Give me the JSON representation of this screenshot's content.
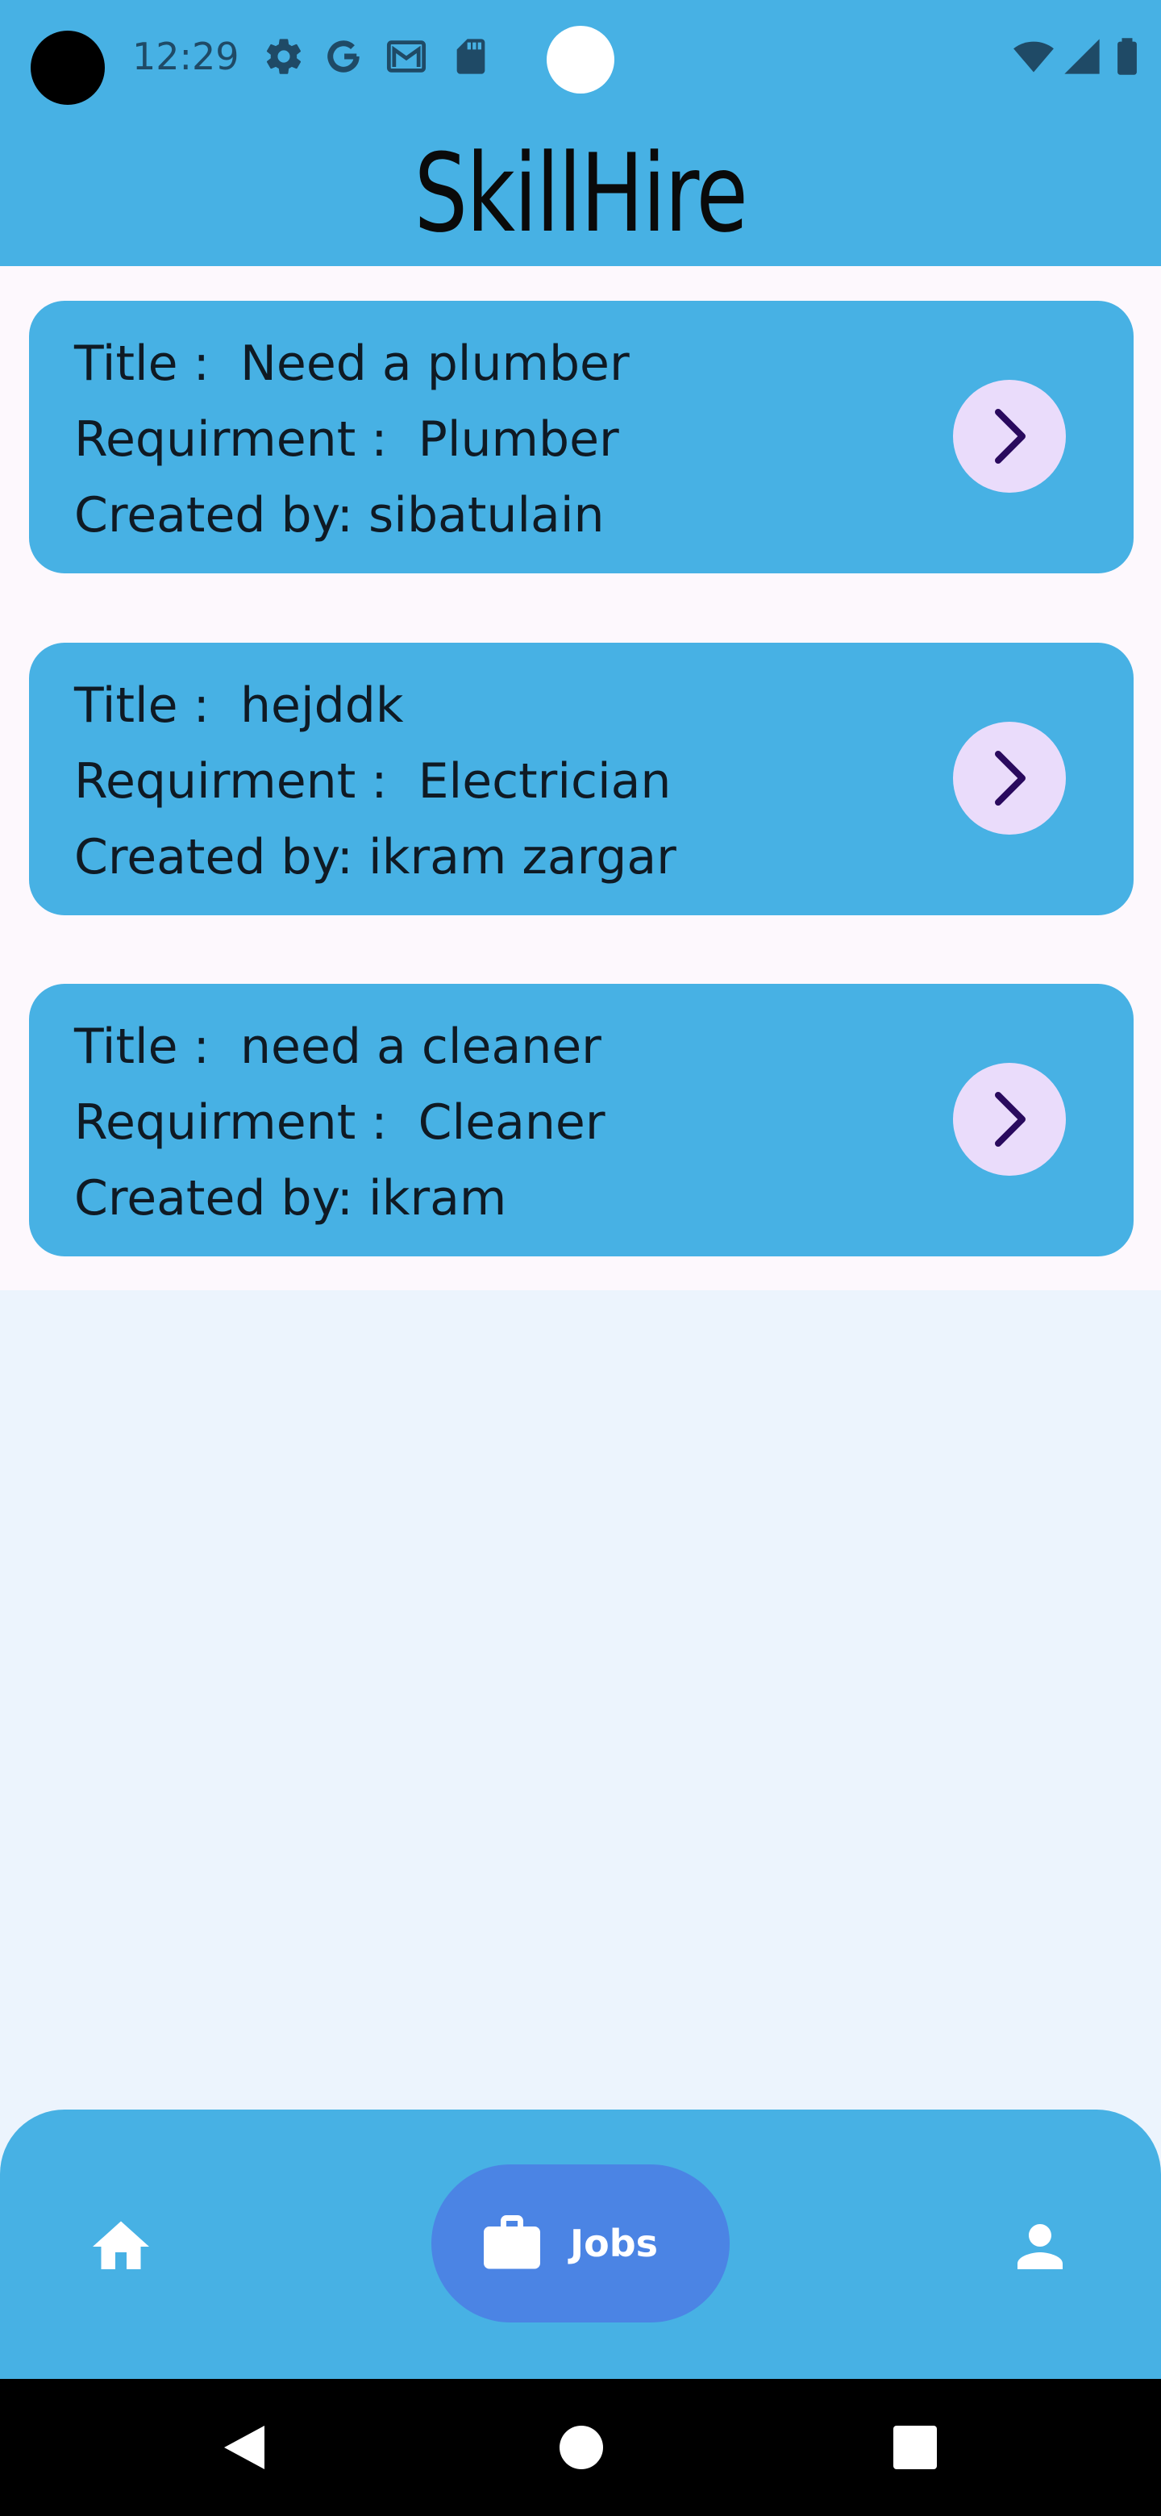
{
  "status_bar": {
    "time": "12:29",
    "icons": [
      "settings-icon",
      "google-icon",
      "gmail-icon",
      "sd-card-icon",
      "wifi-icon",
      "signal-icon",
      "battery-icon"
    ]
  },
  "app": {
    "title": "SkillHire"
  },
  "jobs": [
    {
      "title_line": "Title :  Need a plumber",
      "requirement_line": "Requirment :  Plumber",
      "created_line": "Created by: sibatulain"
    },
    {
      "title_line": "Title :  hejddk",
      "requirement_line": "Requirment :  Electrician",
      "created_line": "Created by: ikram zargar"
    },
    {
      "title_line": "Title :  need a cleaner",
      "requirement_line": "Requirment :  Cleaner",
      "created_line": "Created by: ikram"
    }
  ],
  "bottom_nav": {
    "items": [
      {
        "icon": "home-icon",
        "label": ""
      },
      {
        "icon": "briefcase-icon",
        "label": "Jobs",
        "selected": true
      },
      {
        "icon": "person-icon",
        "label": ""
      }
    ]
  },
  "system_nav": {
    "buttons": [
      "back-icon",
      "home-circle-icon",
      "recents-icon"
    ]
  },
  "colors": {
    "primary": "#47b1e4",
    "nav_selected": "#4b84e4",
    "chevron_bg": "#eadcfb",
    "chevron_fg": "#2a0a5e",
    "page_bg": "#ecf4fd"
  }
}
